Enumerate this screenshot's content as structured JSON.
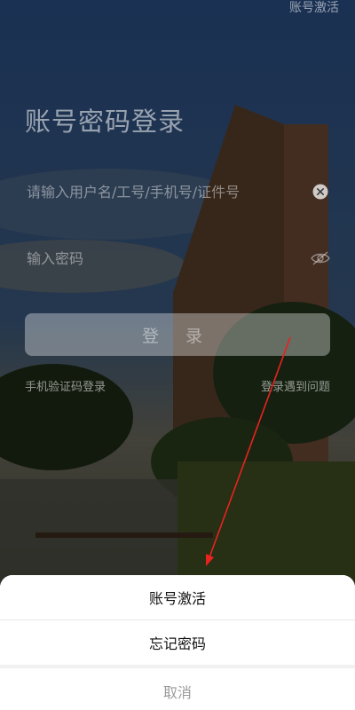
{
  "header": {
    "activate_link": "账号激活"
  },
  "login": {
    "title": "账号密码登录",
    "username_placeholder": "请输入用户名/工号/手机号/证件号",
    "password_placeholder": "输入密码",
    "login_button": "登 录",
    "sms_login": "手机验证码登录",
    "trouble": "登录遇到问题"
  },
  "sheet": {
    "items": [
      {
        "label": "账号激活"
      },
      {
        "label": "忘记密码"
      }
    ],
    "cancel": "取消"
  },
  "icons": {
    "clear": "clear-circle-icon",
    "visibility": "eye-off-icon"
  },
  "colors": {
    "annotation_arrow": "#e8231f",
    "sheet_bg": "#ffffff",
    "cancel_text": "#9a9a9a"
  }
}
